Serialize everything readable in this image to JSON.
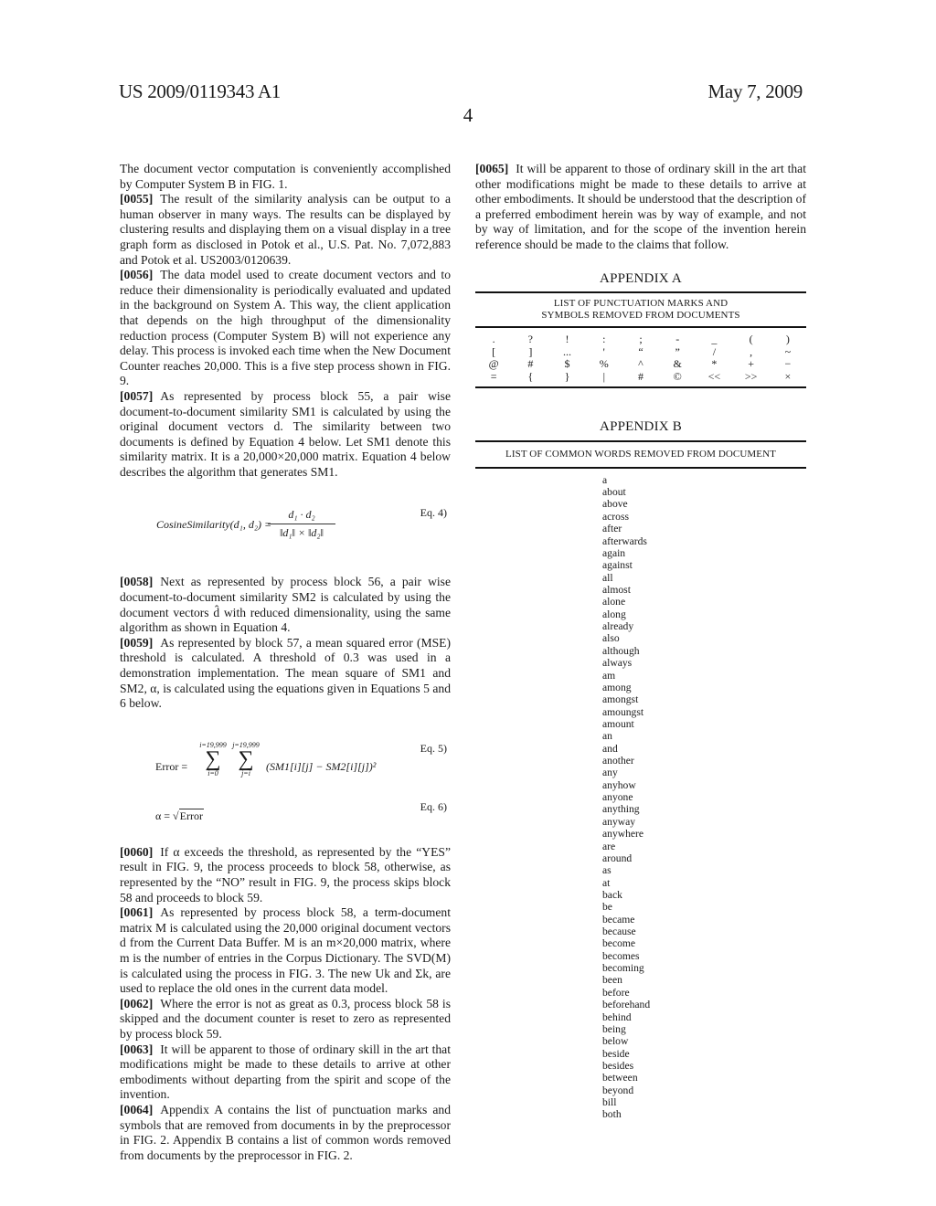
{
  "header": {
    "patent_number": "US 2009/0119343 A1",
    "date": "May 7, 2009",
    "page_number": "4"
  },
  "left_column": {
    "intro": "The document vector computation is conveniently accomplished by Computer System B in FIG. 1.",
    "paragraphs": [
      {
        "num": "[0055]",
        "text": "The result of the similarity analysis can be output to a human observer in many ways. The results can be displayed by clustering results and displaying them on a visual display in a tree graph form as disclosed in Potok et al., U.S. Pat. No. 7,072,883 and Potok et al. US2003/0120639."
      },
      {
        "num": "[0056]",
        "text": "The data model used to create document vectors and to reduce their dimensionality is periodically evaluated and updated in the background on System A. This way, the client application that depends on the high throughput of the dimensionality reduction process (Computer System B) will not experience any delay. This process is invoked each time when the New Document Counter reaches 20,000. This is a five step process shown in FIG. 9."
      },
      {
        "num": "[0057]",
        "text": "As represented by process block 55, a pair wise document-to-document similarity SM1 is calculated by using the original document vectors d. The similarity between two documents is defined by Equation 4 below. Let SM1 denote this similarity matrix. It is a 20,000×20,000 matrix. Equation 4 below describes the algorithm that generates SM1."
      },
      {
        "num": "[0058]",
        "text": "Next as represented by process block 56, a pair wise document-to-document similarity SM2 is calculated by using the document vectors d̂ with reduced dimensionality, using the same algorithm as shown in Equation 4."
      },
      {
        "num": "[0059]",
        "text": "As represented by block 57, a mean squared error (MSE) threshold is calculated. A threshold of 0.3 was used in a demonstration implementation. The mean square of SM1 and SM2, α, is calculated using the equations given in Equations 5 and 6 below."
      },
      {
        "num": "[0060]",
        "text": "If α exceeds the threshold, as represented by the “YES” result in FIG. 9, the process proceeds to block 58, otherwise, as represented by the “NO” result in FIG. 9, the process skips block 58 and proceeds to block 59."
      },
      {
        "num": "[0061]",
        "text": "As represented by process block 58, a term-document matrix M is calculated using the 20,000 original document vectors d from the Current Data Buffer. M is an m×20,000 matrix, where m is the number of entries in the Corpus Dictionary. The SVD(M) is calculated using the process in FIG. 3. The new Uk and Σk, are used to replace the old ones in the current data model."
      },
      {
        "num": "[0062]",
        "text": "Where the error is not as great as 0.3, process block 58 is skipped and the document counter is reset to zero as represented by process block 59."
      },
      {
        "num": "[0063]",
        "text": "It will be apparent to those of ordinary skill in the art that modifications might be made to these details to arrive at other embodiments without departing from the spirit and scope of the invention."
      },
      {
        "num": "[0064]",
        "text": "Appendix A contains the list of punctuation marks and symbols that are removed from documents in by the preprocessor in FIG. 2. Appendix B contains a list of common words removed from documents by the preprocessor in FIG. 2."
      }
    ],
    "equations": {
      "eq4": {
        "lhs": "CosineSimilarity(d₁, d₂) =",
        "numerator": "d₁ · d₂",
        "denominator": "‖d₁‖ × ‖d₂‖",
        "label": "Eq. 4)"
      },
      "eq5": {
        "lhs": "Error =",
        "sum_i_top": "i=19,999",
        "sum_i_bottom": "i=0",
        "sum_j_top": "j=19,999",
        "sum_j_bottom": "j=i",
        "body": "(SM1[i][j] − SM2[i][j])²",
        "label": "Eq. 5)"
      },
      "eq6": {
        "lhs": "α = √",
        "radicand": "Error",
        "label": "Eq. 6)"
      }
    }
  },
  "right_column": {
    "paragraph": {
      "num": "[0065]",
      "text": "It will be apparent to those of ordinary skill in the art that other modifications might be made to these details to arrive at other embodiments. It should be understood that the description of a preferred embodiment herein was by way of example, and not by way of limitation, and for the scope of the invention herein reference should be made to the claims that follow."
    },
    "appendix_a": {
      "title": "APPENDIX A",
      "subtitle_line1": "LIST OF PUNCTUATION MARKS AND",
      "subtitle_line2": "SYMBOLS REMOVED FROM DOCUMENTS",
      "rows": [
        [
          ".",
          "?",
          "!",
          ":",
          ";",
          "-",
          "_",
          "(",
          ")"
        ],
        [
          "[",
          "]",
          "...",
          "'",
          "“",
          "”",
          "/",
          ",",
          "~"
        ],
        [
          "@",
          "#",
          "$",
          "%",
          "^",
          "&",
          "*",
          "+",
          "−"
        ],
        [
          "=",
          "{",
          "}",
          "|",
          "#",
          "©",
          "<<",
          ">>",
          "×"
        ]
      ]
    },
    "appendix_b": {
      "title": "APPENDIX B",
      "subtitle": "LIST OF COMMON WORDS REMOVED FROM DOCUMENT",
      "words": [
        "a",
        "about",
        "above",
        "across",
        "after",
        "afterwards",
        "again",
        "against",
        "all",
        "almost",
        "alone",
        "along",
        "already",
        "also",
        "although",
        "always",
        "am",
        "among",
        "amongst",
        "amoungst",
        "amount",
        "an",
        "and",
        "another",
        "any",
        "anyhow",
        "anyone",
        "anything",
        "anyway",
        "anywhere",
        "are",
        "around",
        "as",
        "at",
        "back",
        "be",
        "became",
        "because",
        "become",
        "becomes",
        "becoming",
        "been",
        "before",
        "beforehand",
        "behind",
        "being",
        "below",
        "beside",
        "besides",
        "between",
        "beyond",
        "bill",
        "both"
      ]
    }
  }
}
